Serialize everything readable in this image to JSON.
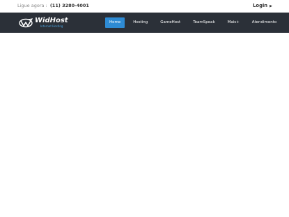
{
  "topbar": {
    "phone_label": "Ligue agora :",
    "phone_number": "(11) 3280-4001",
    "login_label": "Login"
  },
  "brand": {
    "name": "WidHost",
    "tagline": "Internet Hosting",
    "accent_color": "#2e8bd4",
    "navbar_color": "#2b3038"
  },
  "nav": {
    "items": [
      {
        "label": "Home",
        "active": true
      },
      {
        "label": "Hosting"
      },
      {
        "label": "GameHost"
      },
      {
        "label": "TeamSpeak"
      },
      {
        "label": "Mais+"
      },
      {
        "label": "Atendimento"
      }
    ]
  },
  "icons": {
    "login_caret": "chevron-right-icon",
    "logo": "widhost-logo-icon"
  }
}
